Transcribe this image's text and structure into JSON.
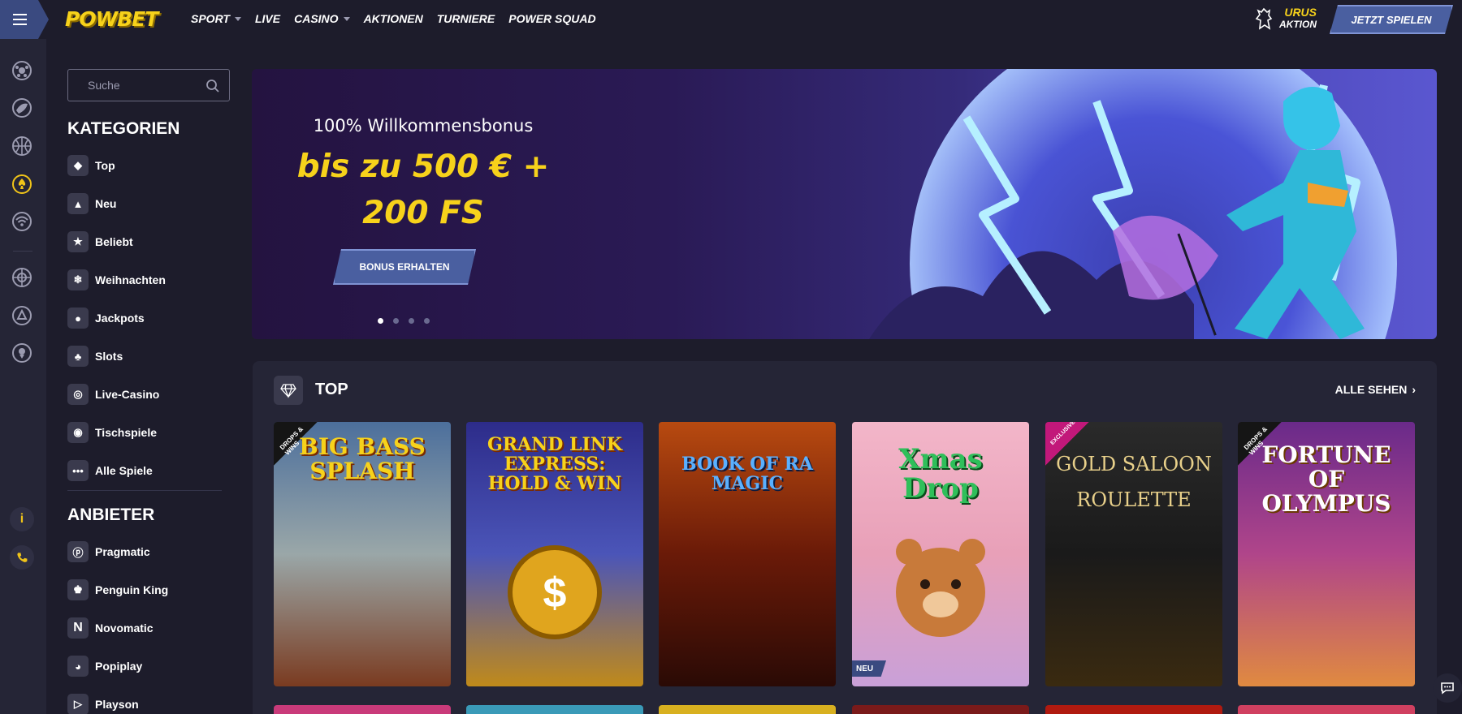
{
  "brand": {
    "logo": "POWBET"
  },
  "nav": {
    "items": [
      {
        "label": "SPORT",
        "caret": true
      },
      {
        "label": "LIVE",
        "caret": false
      },
      {
        "label": "CASINO",
        "caret": true
      },
      {
        "label": "AKTIONEN",
        "caret": false
      },
      {
        "label": "TURNIERE",
        "caret": false
      },
      {
        "label": "POWER SQUAD",
        "caret": false
      }
    ],
    "promo_line1": "URUS",
    "promo_line2": "AKTION",
    "cta": "JETZT SPIELEN"
  },
  "rail": {
    "icons": [
      "soccer-ball-icon",
      "rocket-icon",
      "basketball-icon",
      "casino-chip-icon",
      "live-signal-icon",
      "crosshair-icon",
      "poker-chip-icon",
      "trophy-icon",
      "info-icon",
      "phone-icon"
    ],
    "info_label": "i"
  },
  "sidebar": {
    "search_placeholder": "Suche",
    "categories_title": "KATEGORIEN",
    "categories": [
      {
        "label": "Top",
        "icon": "diamond-icon"
      },
      {
        "label": "Neu",
        "icon": "flame-icon"
      },
      {
        "label": "Beliebt",
        "icon": "star-icon"
      },
      {
        "label": "Weihnachten",
        "icon": "christmas-icon"
      },
      {
        "label": "Jackpots",
        "icon": "jackpot-icon"
      },
      {
        "label": "Slots",
        "icon": "cherries-icon"
      },
      {
        "label": "Live-Casino",
        "icon": "globe-icon"
      },
      {
        "label": "Tischspiele",
        "icon": "table-icon"
      },
      {
        "label": "Alle Spiele",
        "icon": "more-icon"
      }
    ],
    "providers_title": "ANBIETER",
    "providers": [
      {
        "label": "Pragmatic",
        "icon": "pragmatic-logo-icon"
      },
      {
        "label": "Penguin King",
        "icon": "penguin-king-logo-icon"
      },
      {
        "label": "Novomatic",
        "icon": "novomatic-logo-icon"
      },
      {
        "label": "Popiplay",
        "icon": "popiplay-logo-icon"
      },
      {
        "label": "Playson",
        "icon": "playson-logo-icon"
      }
    ]
  },
  "hero": {
    "subtitle": "100% Willkommensbonus",
    "title_line1": "bis zu 500 € +",
    "title_line2": "200 FS",
    "button": "BONUS ERHALTEN",
    "slides": 4,
    "active_slide": 1
  },
  "top_section": {
    "title": "TOP",
    "see_all": "ALLE SEHEN",
    "games": [
      {
        "name": "BIG BASS SPLASH",
        "badge": "DROPS & WINS",
        "colors": [
          "#4c6f9c",
          "#9aa7a8",
          "#7a3b20"
        ]
      },
      {
        "name": "GRAND LINK EXPRESS: HOLD & WIN",
        "badge": "",
        "colors": [
          "#2d2c8a",
          "#4b55b8",
          "#c08a1a"
        ]
      },
      {
        "name": "BOOK OF RA MAGIC",
        "badge": "",
        "colors": [
          "#b84a10",
          "#6a1a08",
          "#2a0a05"
        ]
      },
      {
        "name": "Xmas Drop",
        "badge": "NEU",
        "colors": [
          "#f3b6c9",
          "#e8a0b8",
          "#c9a0d8"
        ]
      },
      {
        "name": "GOLD SALOON ROULETTE",
        "badge": "EXCLUSIVE",
        "colors": [
          "#2a2a2a",
          "#1a1a1a",
          "#3a2a10"
        ]
      },
      {
        "name": "FORTUNE OF OLYMPUS",
        "badge": "DROPS & WINS",
        "colors": [
          "#6a2a8a",
          "#b0458a",
          "#e08a40"
        ]
      }
    ],
    "row2_colors": [
      "#c93a7a",
      "#3a9ab8",
      "#d8b020",
      "#7a1a1a",
      "#b01a10",
      "#d04060"
    ]
  }
}
